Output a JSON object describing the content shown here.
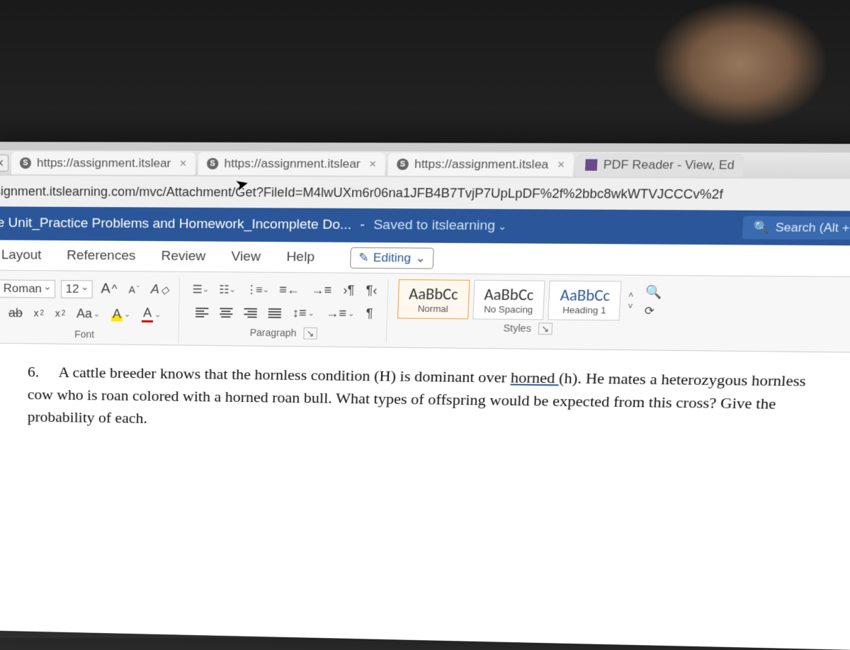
{
  "browser": {
    "tabs": [
      {
        "title": "https://assignment.itslear",
        "favicon": "S"
      },
      {
        "title": "https://assignment.itslear",
        "favicon": "S"
      },
      {
        "title": "https://assignment.itslea",
        "favicon": "S"
      },
      {
        "title": "PDF Reader - View, Ed",
        "type": "pdf"
      }
    ],
    "close_x": "×",
    "address": "signment.itslearning.com/mvc/Attachment/Get?FileId=M4lwUXm6r06na1JFB4B7TvjP7UpLpDF%2f%2bbc8wkWTVJCCCv%2f"
  },
  "word": {
    "title": "e Unit_Practice Problems and Homework_Incomplete Do...",
    "saved": "Saved to itslearning",
    "search_placeholder": "Search (Alt + Q)",
    "tabs": [
      "Layout",
      "References",
      "Review",
      "View",
      "Help"
    ],
    "editing": "Editing"
  },
  "ribbon": {
    "font_name": "Roman",
    "font_size": "12",
    "grow": "A",
    "shrink": "A",
    "clear": "A",
    "strike": "ab",
    "sub": "x",
    "sup": "x",
    "case": "Aa",
    "highlight": "A",
    "color": "A",
    "group_font": "Font",
    "group_paragraph": "Paragraph",
    "group_styles": "Styles",
    "pilcrow": "¶",
    "styles": [
      {
        "sample": "AaBbCc",
        "label": "Normal"
      },
      {
        "sample": "AaBbCc",
        "label": "No Spacing"
      },
      {
        "sample": "AaBbCc",
        "label": "Heading 1"
      }
    ]
  },
  "document": {
    "item_num": "6.",
    "text_1": "A cattle breeder knows that the hornless condition (H) is dominant over ",
    "text_horned": "horned ",
    "text_2": "(h).  He mates a heterozygous hornless cow who is roan colored with a horned roan bull.  What types of offspring would be expected from this cross? Give the probability of each."
  }
}
